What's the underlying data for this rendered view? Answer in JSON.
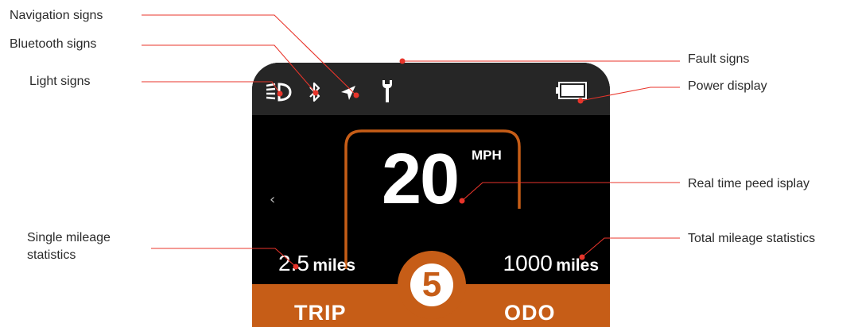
{
  "callouts": {
    "navigation": "Navigation signs",
    "bluetooth": "Bluetooth signs",
    "light": "Light  signs",
    "fault": "Fault signs",
    "power": "Power display",
    "speed": "Real time peed isplay",
    "single_line1": "Single mileage",
    "single_line2": "statistics",
    "total": "Total mileage statistics"
  },
  "display": {
    "speed": "20",
    "speed_unit": "MPH",
    "back_glyph": "‹",
    "trip_value": "2.5",
    "trip_unit": "miles",
    "odo_value": "1000",
    "odo_unit": "miles",
    "gear": "5",
    "trip_label": "TRIP",
    "odo_label": "ODO"
  },
  "icons": [
    "headlight-icon",
    "bluetooth-icon",
    "navigation-arrow-icon",
    "wrench-icon",
    "battery-icon"
  ],
  "colors": {
    "accent": "#c65d17",
    "leader_line": "#e8352b",
    "screen": "#000000",
    "status_bar": "#262626",
    "battery_fill": "#ffffff"
  },
  "battery_level": 0.95
}
